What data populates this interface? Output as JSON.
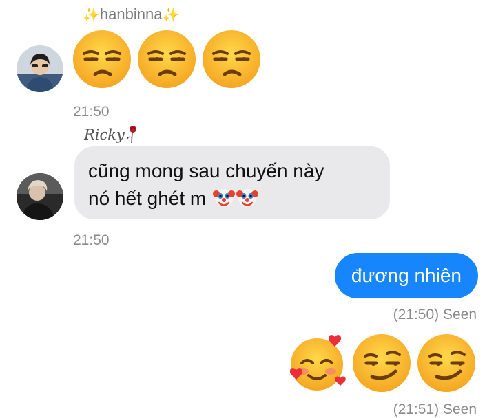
{
  "messages": {
    "group1": {
      "sender": "hanbinna",
      "sparkle_left": "✨",
      "sparkle_right": "✨",
      "emojis": [
        "unamused-face",
        "unamused-face",
        "unamused-face"
      ],
      "time": "21:50"
    },
    "group2": {
      "sender_signature": "Ricky",
      "text_line1": "cũng mong sau chuyến này",
      "text_line2": "nó hết ghét m",
      "emojis": [
        "clown-face",
        "clown-face"
      ],
      "time": "21:50"
    },
    "outgoing1": {
      "text": "đương nhiên",
      "status": "(21:50) Seen"
    },
    "outgoing2": {
      "emojis": [
        "smiling-face-with-hearts",
        "smirking-face",
        "smirking-face"
      ],
      "status": "(21:51) Seen"
    }
  },
  "colors": {
    "incoming_bubble": "#e9e9eb",
    "outgoing_bubble": "#1785fc",
    "timestamp": "#8a8a8a"
  }
}
